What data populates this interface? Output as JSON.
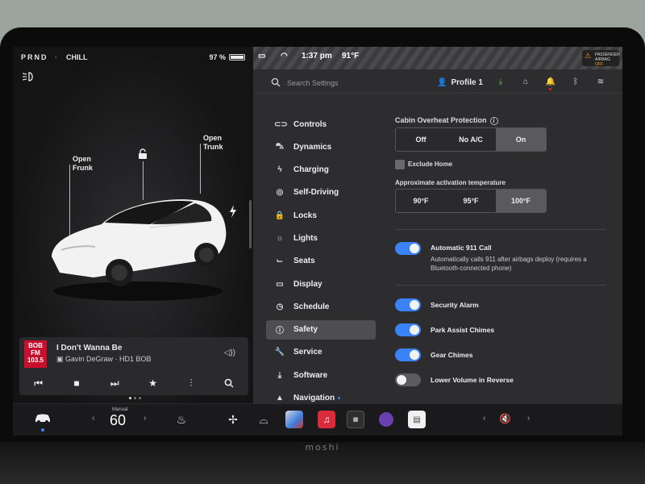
{
  "status": {
    "gear": "PRND",
    "separator": "·",
    "drive_mode": "CHILL",
    "battery_percent": "97 %",
    "battery_level": 0.97
  },
  "car": {
    "open_frunk": [
      "Open",
      "Frunk"
    ],
    "open_trunk": [
      "Open",
      "Trunk"
    ]
  },
  "media": {
    "station_art": [
      "BOB",
      "FM",
      "103.5"
    ],
    "title": "I Don't Wanna Be",
    "subtitle": "Gavin DeGraw · HD1 BOB"
  },
  "map_status": {
    "time": "1:37 pm",
    "temperature": "91°F",
    "airbag_lines": [
      "PASSENGER",
      "AIRBAG"
    ],
    "airbag_state": "OFF"
  },
  "header": {
    "search_placeholder": "Search Settings",
    "profile_label": "Profile 1"
  },
  "nav": {
    "items": [
      {
        "label": "Controls",
        "icon": "toggle-icon"
      },
      {
        "label": "Dynamics",
        "icon": "car-icon"
      },
      {
        "label": "Charging",
        "icon": "bolt-icon"
      },
      {
        "label": "Self-Driving",
        "icon": "steering-wheel-icon"
      },
      {
        "label": "Locks",
        "icon": "lock-icon"
      },
      {
        "label": "Lights",
        "icon": "sun-icon"
      },
      {
        "label": "Seats",
        "icon": "seat-icon"
      },
      {
        "label": "Display",
        "icon": "display-icon"
      },
      {
        "label": "Schedule",
        "icon": "clock-icon"
      },
      {
        "label": "Safety",
        "icon": "info-circle-icon",
        "active": true
      },
      {
        "label": "Service",
        "icon": "wrench-icon"
      },
      {
        "label": "Software",
        "icon": "download-icon"
      },
      {
        "label": "Navigation",
        "icon": "navigation-arrow-icon"
      }
    ]
  },
  "safety": {
    "cabin_overheat": {
      "label": "Cabin Overheat Protection",
      "info": "i",
      "options": [
        "Off",
        "No A/C",
        "On"
      ],
      "selected": "On"
    },
    "exclude_home": {
      "label": "Exclude Home",
      "checked": false
    },
    "activation_temp": {
      "label": "Approximate activation temperature",
      "options": [
        "90°F",
        "95°F",
        "100°F"
      ],
      "selected": "100°F"
    },
    "auto_911": {
      "label": "Automatic 911 Call",
      "description": "Automatically calls 911 after airbags deploy (requires a Bluetooth-connected phone)",
      "on": true
    },
    "security_alarm": {
      "label": "Security Alarm",
      "on": true
    },
    "park_assist_chimes": {
      "label": "Park Assist Chimes",
      "on": true
    },
    "gear_chimes": {
      "label": "Gear Chimes",
      "on": true
    },
    "lower_volume_reverse": {
      "label": "Lower Volume in Reverse",
      "on": false
    }
  },
  "dock": {
    "climate_mode": "Manual",
    "climate_temp": "60",
    "chevron_left": "‹",
    "chevron_right": "›",
    "volume_icon": "🔇"
  },
  "footer": {
    "brand": "moshi"
  },
  "colors": {
    "accent": "#3b82f6",
    "download_green": "#4bd24b",
    "warning_orange": "#f5a623"
  }
}
